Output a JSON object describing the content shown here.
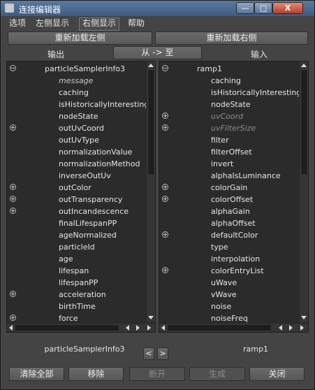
{
  "window": {
    "title": "连接编辑器",
    "min": "—",
    "max": "□",
    "close": "X"
  },
  "menubar": [
    {
      "label": "选项"
    },
    {
      "label": "左侧显示"
    },
    {
      "label": "右侧显示"
    },
    {
      "label": "帮助"
    }
  ],
  "toolbar": {
    "reload_left": "重新加载左侧",
    "reload_right": "重新加载右侧",
    "output_label": "输出",
    "direction": "从 -> 至",
    "input_label": "输入"
  },
  "left_panel": {
    "rows": [
      {
        "expander": "minus",
        "text": "particleSamplerInfo3",
        "style": "header"
      },
      {
        "expander": "",
        "text": "message",
        "style": "italic"
      },
      {
        "expander": "",
        "text": "caching",
        "style": ""
      },
      {
        "expander": "",
        "text": "isHistoricallyInteresting",
        "style": ""
      },
      {
        "expander": "",
        "text": "nodeState",
        "style": ""
      },
      {
        "expander": "plus",
        "text": "outUvCoord",
        "style": ""
      },
      {
        "expander": "",
        "text": "outUvType",
        "style": ""
      },
      {
        "expander": "",
        "text": "normalizationValue",
        "style": ""
      },
      {
        "expander": "",
        "text": "normalizationMethod",
        "style": ""
      },
      {
        "expander": "",
        "text": "inverseOutUv",
        "style": ""
      },
      {
        "expander": "plus",
        "text": "outColor",
        "style": ""
      },
      {
        "expander": "plus",
        "text": "outTransparency",
        "style": ""
      },
      {
        "expander": "plus",
        "text": "outIncandescence",
        "style": ""
      },
      {
        "expander": "",
        "text": "finalLifespanPP",
        "style": ""
      },
      {
        "expander": "",
        "text": "ageNormalized",
        "style": ""
      },
      {
        "expander": "",
        "text": "particleId",
        "style": ""
      },
      {
        "expander": "",
        "text": "age",
        "style": ""
      },
      {
        "expander": "",
        "text": "lifespan",
        "style": ""
      },
      {
        "expander": "",
        "text": "lifespanPP",
        "style": ""
      },
      {
        "expander": "plus",
        "text": "acceleration",
        "style": ""
      },
      {
        "expander": "",
        "text": "birthTime",
        "style": ""
      },
      {
        "expander": "plus",
        "text": "force",
        "style": ""
      }
    ]
  },
  "right_panel": {
    "rows": [
      {
        "expander": "minus",
        "text": "ramp1",
        "style": "header"
      },
      {
        "expander": "",
        "text": "caching",
        "style": ""
      },
      {
        "expander": "",
        "text": "isHistoricallyInteresting",
        "style": ""
      },
      {
        "expander": "",
        "text": "nodeState",
        "style": ""
      },
      {
        "expander": "plus",
        "text": "uvCoord",
        "style": "dim"
      },
      {
        "expander": "plus",
        "text": "uvFilterSize",
        "style": "dim"
      },
      {
        "expander": "",
        "text": "filter",
        "style": ""
      },
      {
        "expander": "",
        "text": "filterOffset",
        "style": ""
      },
      {
        "expander": "",
        "text": "invert",
        "style": ""
      },
      {
        "expander": "",
        "text": "alphaIsLuminance",
        "style": ""
      },
      {
        "expander": "plus",
        "text": "colorGain",
        "style": ""
      },
      {
        "expander": "plus",
        "text": "colorOffset",
        "style": ""
      },
      {
        "expander": "",
        "text": "alphaGain",
        "style": ""
      },
      {
        "expander": "",
        "text": "alphaOffset",
        "style": ""
      },
      {
        "expander": "plus",
        "text": "defaultColor",
        "style": ""
      },
      {
        "expander": "",
        "text": "type",
        "style": ""
      },
      {
        "expander": "",
        "text": "interpolation",
        "style": ""
      },
      {
        "expander": "plus",
        "text": "colorEntryList",
        "style": ""
      },
      {
        "expander": "",
        "text": "uWave",
        "style": ""
      },
      {
        "expander": "",
        "text": "vWave",
        "style": ""
      },
      {
        "expander": "",
        "text": "noise",
        "style": ""
      },
      {
        "expander": "",
        "text": "noiseFreq",
        "style": ""
      }
    ]
  },
  "footer": {
    "left_node": "particleSamplerInfo3",
    "right_node": "ramp1",
    "prev": "<",
    "next": ">"
  },
  "bottom_buttons": {
    "clear_all": "清除全部",
    "remove": "移除",
    "break": "断开",
    "make": "生成",
    "close": "关闭"
  }
}
